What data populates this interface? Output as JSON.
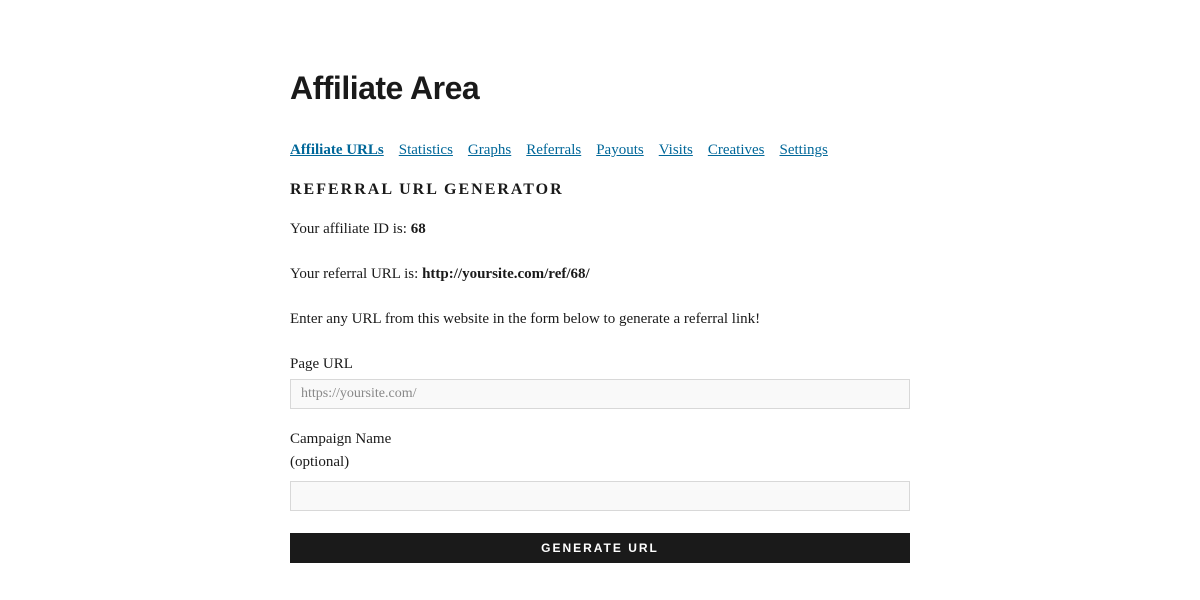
{
  "page_title": "Affiliate Area",
  "tabs": [
    "Affiliate URLs",
    "Statistics",
    "Graphs",
    "Referrals",
    "Payouts",
    "Visits",
    "Creatives",
    "Settings"
  ],
  "section_heading": "REFERRAL URL GENERATOR",
  "affiliate_id_label": "Your affiliate ID is: ",
  "affiliate_id_value": "68",
  "referral_url_label": "Your referral URL is: ",
  "referral_url_value": "http://yoursite.com/ref/68/",
  "instructions": "Enter any URL from this website in the form below to generate a referral link!",
  "form": {
    "page_url_label": "Page URL",
    "page_url_placeholder": "https://yoursite.com/",
    "page_url_value": "",
    "campaign_label": "Campaign Name",
    "campaign_sublabel": "(optional)",
    "campaign_value": "",
    "button_label": "GENERATE URL"
  }
}
